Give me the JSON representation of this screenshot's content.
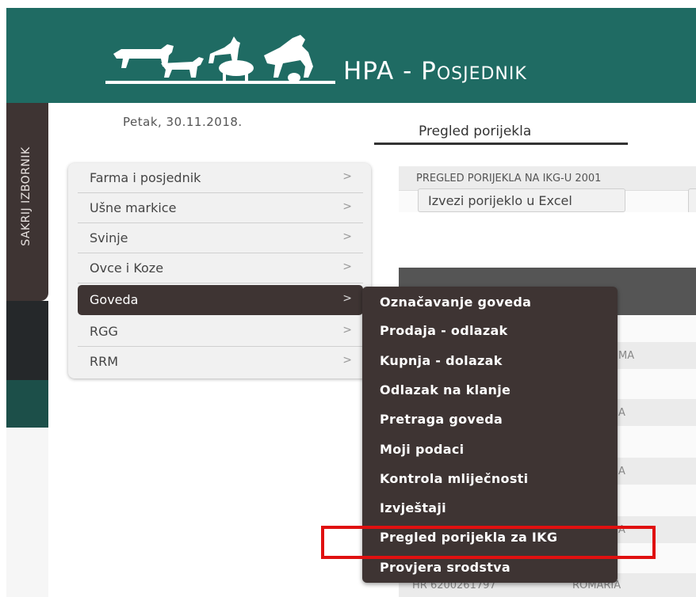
{
  "header": {
    "title": "HPA - Posjednik",
    "title_prefix": "HPA - ",
    "title_main": "Posjednik",
    "bg_color": "#1f6b63"
  },
  "sidebar_tab": {
    "label": "SAKRIJ IZBORNIK"
  },
  "date": "Petak, 30.11.2018.",
  "tab": {
    "label": "Pregled porijekla"
  },
  "menu": {
    "items": [
      {
        "label": "Farma i posjednik",
        "active": false
      },
      {
        "label": "Ušne markice",
        "active": false
      },
      {
        "label": "Svinje",
        "active": false
      },
      {
        "label": "Ovce i Koze",
        "active": false
      },
      {
        "label": "Goveda",
        "active": true
      },
      {
        "label": "RGG",
        "active": false
      },
      {
        "label": "RRM",
        "active": false
      }
    ]
  },
  "submenu": {
    "items": [
      "Označavanje goveda",
      "Prodaja - odlazak",
      "Kupnja - dolazak",
      "Odlazak na klanje",
      "Pretraga goveda",
      "Moji podaci",
      "Kontrola mliječnosti",
      "Izvještaji",
      "Pregled porijekla za IKG",
      "Provjera srodstva"
    ],
    "highlighted": "Pregled porijekla za IKG"
  },
  "panel": {
    "header": "PREGLED PORIJEKLA NA IKG-U 2001",
    "export_button": "Izvezi porijeklo u Excel",
    "rows": [
      {
        "col2": "MA"
      },
      {
        "col2": "A"
      },
      {
        "col2": "A"
      },
      {
        "col2": "A"
      },
      {
        "col1": "HR 6200261797",
        "col2": "ROMARIA"
      }
    ]
  },
  "colors": {
    "menu_active": "#3e3433",
    "highlight_border": "#e01010"
  }
}
